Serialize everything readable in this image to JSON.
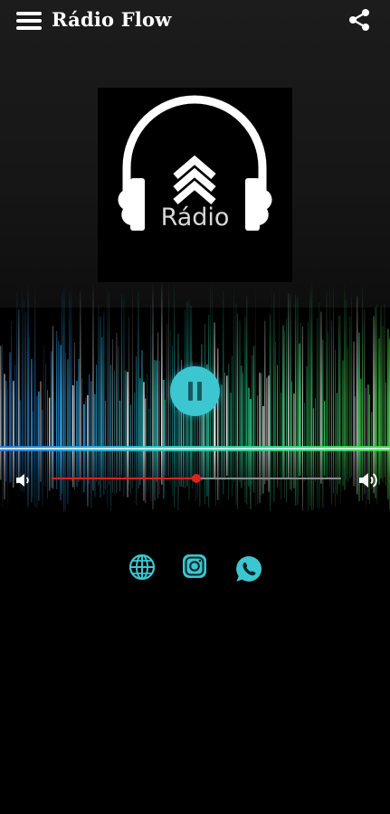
{
  "app": {
    "title": "Rádio Flow"
  },
  "logo": {
    "word": "Rádio"
  },
  "player": {
    "state": "playing",
    "volume_fraction": 0.5
  },
  "colors": {
    "accent": "#3cc6cf",
    "volume": "#e0211e",
    "background": "#000000"
  },
  "icons": {
    "menu": "hamburger-menu-icon",
    "share": "share-icon",
    "pause": "pause-icon",
    "volume_low": "volume-low-icon",
    "volume_high": "volume-high-icon",
    "website": "globe-icon",
    "instagram": "instagram-icon",
    "whatsapp": "whatsapp-icon"
  }
}
